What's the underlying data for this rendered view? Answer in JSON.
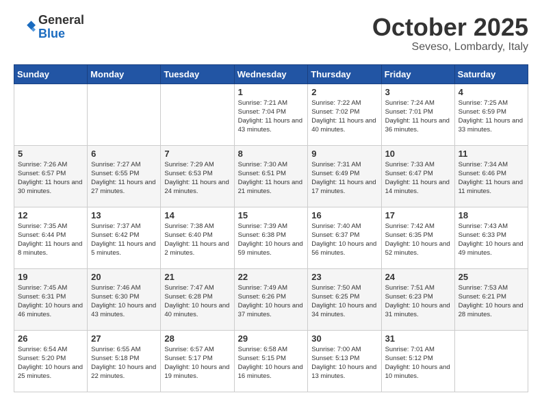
{
  "header": {
    "logo_general": "General",
    "logo_blue": "Blue",
    "month_title": "October 2025",
    "location": "Seveso, Lombardy, Italy"
  },
  "weekdays": [
    "Sunday",
    "Monday",
    "Tuesday",
    "Wednesday",
    "Thursday",
    "Friday",
    "Saturday"
  ],
  "weeks": [
    [
      {
        "day": "",
        "info": ""
      },
      {
        "day": "",
        "info": ""
      },
      {
        "day": "",
        "info": ""
      },
      {
        "day": "1",
        "info": "Sunrise: 7:21 AM\nSunset: 7:04 PM\nDaylight: 11 hours\nand 43 minutes."
      },
      {
        "day": "2",
        "info": "Sunrise: 7:22 AM\nSunset: 7:02 PM\nDaylight: 11 hours\nand 40 minutes."
      },
      {
        "day": "3",
        "info": "Sunrise: 7:24 AM\nSunset: 7:01 PM\nDaylight: 11 hours\nand 36 minutes."
      },
      {
        "day": "4",
        "info": "Sunrise: 7:25 AM\nSunset: 6:59 PM\nDaylight: 11 hours\nand 33 minutes."
      }
    ],
    [
      {
        "day": "5",
        "info": "Sunrise: 7:26 AM\nSunset: 6:57 PM\nDaylight: 11 hours\nand 30 minutes."
      },
      {
        "day": "6",
        "info": "Sunrise: 7:27 AM\nSunset: 6:55 PM\nDaylight: 11 hours\nand 27 minutes."
      },
      {
        "day": "7",
        "info": "Sunrise: 7:29 AM\nSunset: 6:53 PM\nDaylight: 11 hours\nand 24 minutes."
      },
      {
        "day": "8",
        "info": "Sunrise: 7:30 AM\nSunset: 6:51 PM\nDaylight: 11 hours\nand 21 minutes."
      },
      {
        "day": "9",
        "info": "Sunrise: 7:31 AM\nSunset: 6:49 PM\nDaylight: 11 hours\nand 17 minutes."
      },
      {
        "day": "10",
        "info": "Sunrise: 7:33 AM\nSunset: 6:47 PM\nDaylight: 11 hours\nand 14 minutes."
      },
      {
        "day": "11",
        "info": "Sunrise: 7:34 AM\nSunset: 6:46 PM\nDaylight: 11 hours\nand 11 minutes."
      }
    ],
    [
      {
        "day": "12",
        "info": "Sunrise: 7:35 AM\nSunset: 6:44 PM\nDaylight: 11 hours\nand 8 minutes."
      },
      {
        "day": "13",
        "info": "Sunrise: 7:37 AM\nSunset: 6:42 PM\nDaylight: 11 hours\nand 5 minutes."
      },
      {
        "day": "14",
        "info": "Sunrise: 7:38 AM\nSunset: 6:40 PM\nDaylight: 11 hours\nand 2 minutes."
      },
      {
        "day": "15",
        "info": "Sunrise: 7:39 AM\nSunset: 6:38 PM\nDaylight: 10 hours\nand 59 minutes."
      },
      {
        "day": "16",
        "info": "Sunrise: 7:40 AM\nSunset: 6:37 PM\nDaylight: 10 hours\nand 56 minutes."
      },
      {
        "day": "17",
        "info": "Sunrise: 7:42 AM\nSunset: 6:35 PM\nDaylight: 10 hours\nand 52 minutes."
      },
      {
        "day": "18",
        "info": "Sunrise: 7:43 AM\nSunset: 6:33 PM\nDaylight: 10 hours\nand 49 minutes."
      }
    ],
    [
      {
        "day": "19",
        "info": "Sunrise: 7:45 AM\nSunset: 6:31 PM\nDaylight: 10 hours\nand 46 minutes."
      },
      {
        "day": "20",
        "info": "Sunrise: 7:46 AM\nSunset: 6:30 PM\nDaylight: 10 hours\nand 43 minutes."
      },
      {
        "day": "21",
        "info": "Sunrise: 7:47 AM\nSunset: 6:28 PM\nDaylight: 10 hours\nand 40 minutes."
      },
      {
        "day": "22",
        "info": "Sunrise: 7:49 AM\nSunset: 6:26 PM\nDaylight: 10 hours\nand 37 minutes."
      },
      {
        "day": "23",
        "info": "Sunrise: 7:50 AM\nSunset: 6:25 PM\nDaylight: 10 hours\nand 34 minutes."
      },
      {
        "day": "24",
        "info": "Sunrise: 7:51 AM\nSunset: 6:23 PM\nDaylight: 10 hours\nand 31 minutes."
      },
      {
        "day": "25",
        "info": "Sunrise: 7:53 AM\nSunset: 6:21 PM\nDaylight: 10 hours\nand 28 minutes."
      }
    ],
    [
      {
        "day": "26",
        "info": "Sunrise: 6:54 AM\nSunset: 5:20 PM\nDaylight: 10 hours\nand 25 minutes."
      },
      {
        "day": "27",
        "info": "Sunrise: 6:55 AM\nSunset: 5:18 PM\nDaylight: 10 hours\nand 22 minutes."
      },
      {
        "day": "28",
        "info": "Sunrise: 6:57 AM\nSunset: 5:17 PM\nDaylight: 10 hours\nand 19 minutes."
      },
      {
        "day": "29",
        "info": "Sunrise: 6:58 AM\nSunset: 5:15 PM\nDaylight: 10 hours\nand 16 minutes."
      },
      {
        "day": "30",
        "info": "Sunrise: 7:00 AM\nSunset: 5:13 PM\nDaylight: 10 hours\nand 13 minutes."
      },
      {
        "day": "31",
        "info": "Sunrise: 7:01 AM\nSunset: 5:12 PM\nDaylight: 10 hours\nand 10 minutes."
      },
      {
        "day": "",
        "info": ""
      }
    ]
  ]
}
